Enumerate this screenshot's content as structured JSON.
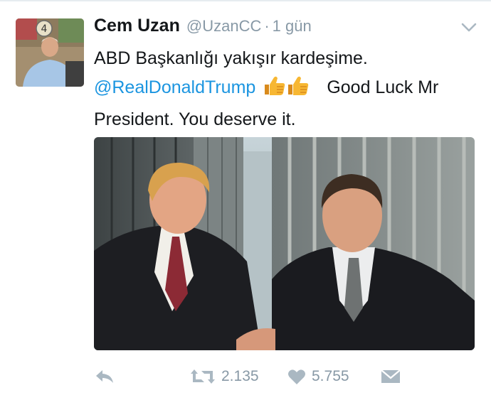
{
  "tweet": {
    "author_name": "Cem Uzan",
    "handle": "@UzanCC",
    "separator": "·",
    "time": "1 gün",
    "line1": "ABD Başkanlığı yakışır kardeşime.",
    "mention": "@RealDonaldTrump",
    "emoji_icon": "thumbs-up-icon",
    "line2_tail": "Good Luck Mr",
    "line3": "President. You deserve it."
  },
  "avatar": {
    "badge_number": "4"
  },
  "actions": {
    "reply_icon": "reply-icon",
    "retweet_icon": "retweet-icon",
    "retweet_count": "2.135",
    "like_icon": "heart-icon",
    "like_count": "5.755",
    "dm_icon": "envelope-icon"
  },
  "colors": {
    "text": "#14171a",
    "muted": "#8899a6",
    "link": "#1b95e0"
  }
}
